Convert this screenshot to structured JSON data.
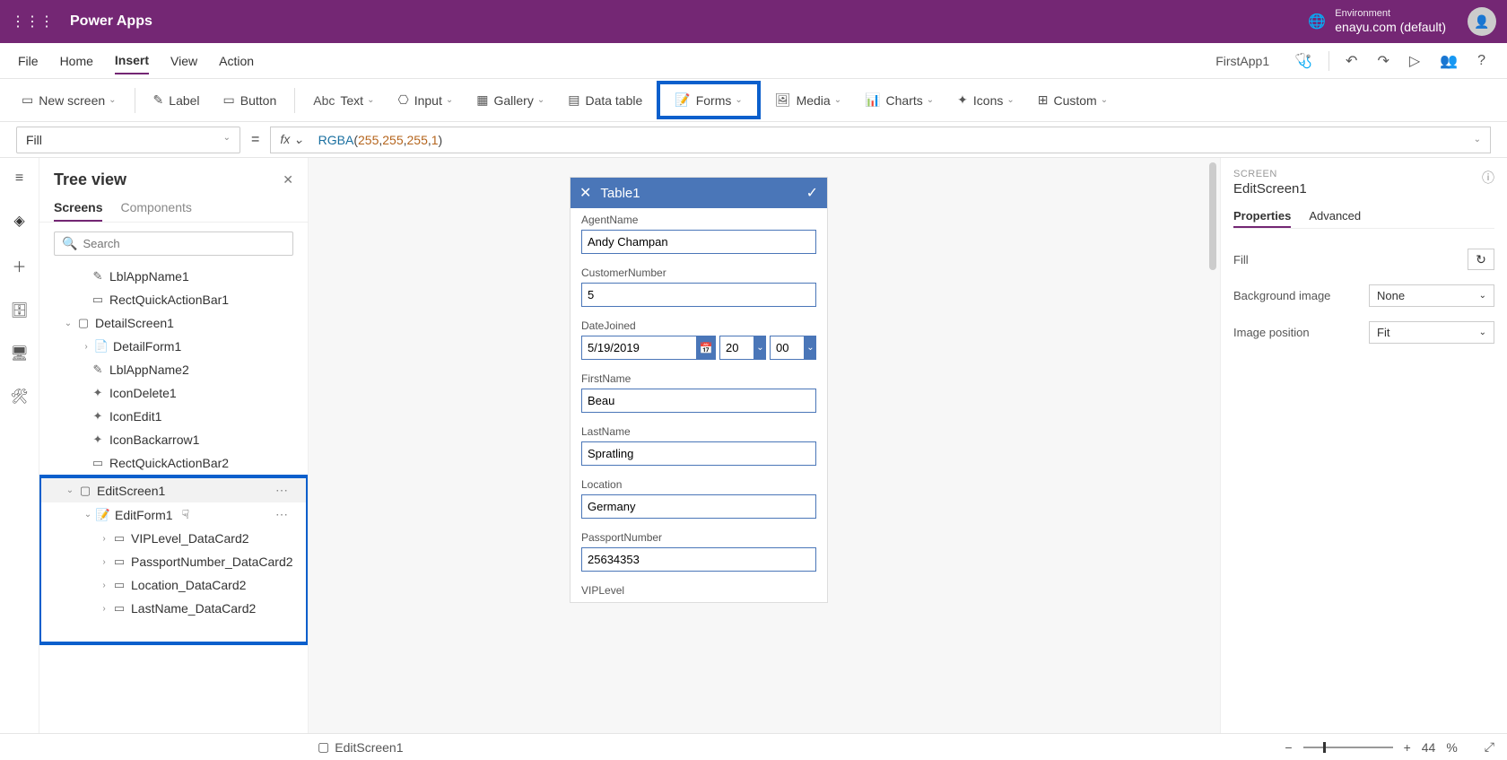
{
  "header": {
    "appTitle": "Power Apps",
    "envLabel": "Environment",
    "envName": "enayu.com (default)"
  },
  "menu": {
    "items": [
      "File",
      "Home",
      "Insert",
      "View",
      "Action"
    ],
    "activeIndex": 2,
    "appName": "FirstApp1"
  },
  "ribbon": {
    "newScreen": "New screen",
    "label": "Label",
    "button": "Button",
    "text": "Text",
    "input": "Input",
    "gallery": "Gallery",
    "dataTable": "Data table",
    "forms": "Forms",
    "media": "Media",
    "charts": "Charts",
    "icons": "Icons",
    "custom": "Custom"
  },
  "formula": {
    "property": "Fill",
    "fn": "RGBA",
    "args": [
      "255",
      "255",
      "255",
      "1"
    ]
  },
  "tree": {
    "title": "Tree view",
    "tabs": [
      "Screens",
      "Components"
    ],
    "activeTab": 0,
    "searchPlaceholder": "Search",
    "nodes": {
      "lblAppName1": "LblAppName1",
      "rectQAB1": "RectQuickActionBar1",
      "detailScreen1": "DetailScreen1",
      "detailForm1": "DetailForm1",
      "lblAppName2": "LblAppName2",
      "iconDelete1": "IconDelete1",
      "iconEdit1": "IconEdit1",
      "iconBackarrow1": "IconBackarrow1",
      "rectQAB2": "RectQuickActionBar2",
      "editScreen1": "EditScreen1",
      "editForm1": "EditForm1",
      "vipLevelDC2": "VIPLevel_DataCard2",
      "passportDC2": "PassportNumber_DataCard2",
      "locationDC2": "Location_DataCard2",
      "lastNameDC2": "LastName_DataCard2"
    }
  },
  "form": {
    "title": "Table1",
    "agentName": {
      "label": "AgentName",
      "value": "Andy Champan"
    },
    "customerNumber": {
      "label": "CustomerNumber",
      "value": "5"
    },
    "dateJoined": {
      "label": "DateJoined",
      "value": "5/19/2019",
      "hour": "20",
      "minute": "00"
    },
    "firstName": {
      "label": "FirstName",
      "value": "Beau"
    },
    "lastName": {
      "label": "LastName",
      "value": "Spratling"
    },
    "location": {
      "label": "Location",
      "value": "Germany"
    },
    "passportNumber": {
      "label": "PassportNumber",
      "value": "25634353"
    },
    "vipLevel": {
      "label": "VIPLevel"
    }
  },
  "rightPanel": {
    "section": "SCREEN",
    "screenName": "EditScreen1",
    "tabs": [
      "Properties",
      "Advanced"
    ],
    "activeTab": 0,
    "fillLabel": "Fill",
    "bgImageLabel": "Background image",
    "bgImageValue": "None",
    "imgPosLabel": "Image position",
    "imgPosValue": "Fit"
  },
  "status": {
    "screenName": "EditScreen1",
    "zoomValue": "44",
    "zoomUnit": "%"
  }
}
